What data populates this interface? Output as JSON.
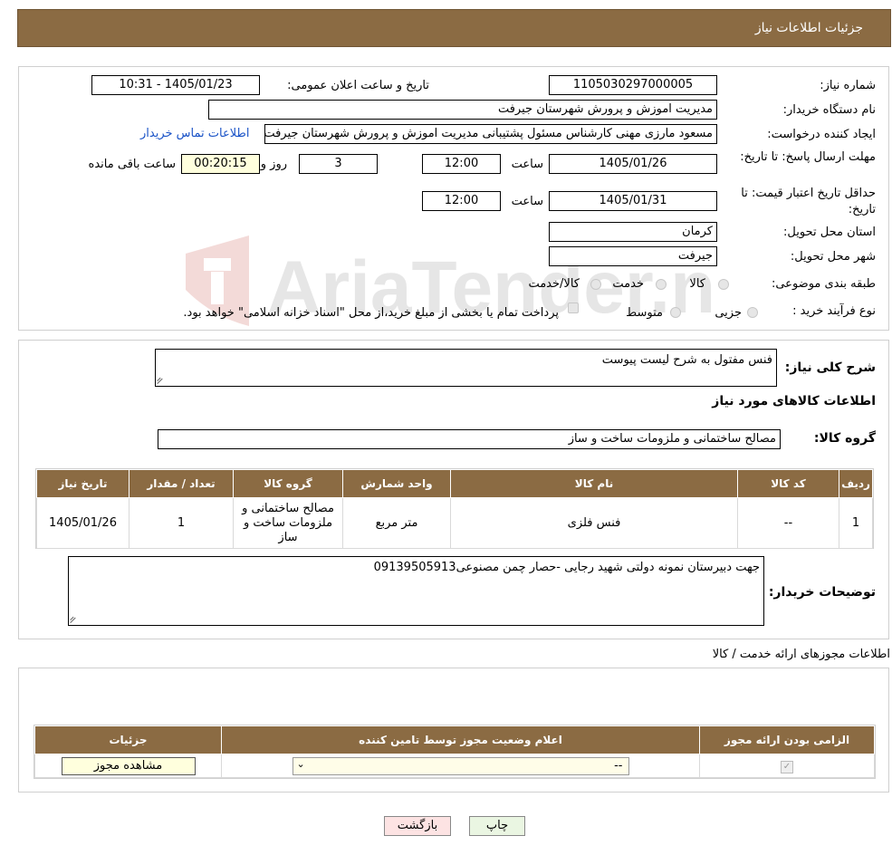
{
  "header": {
    "title": "جزئیات اطلاعات نیاز"
  },
  "watermark": {
    "text": "AriaTender.neT"
  },
  "form": {
    "need_number_label": "شماره نیاز:",
    "need_number": "1105030297000005",
    "announce_label": "تاریخ و ساعت اعلان عمومی:",
    "announce_value": "1405/01/23 - 10:31",
    "buyer_org_label": "نام دستگاه خریدار:",
    "buyer_org": "مدیریت اموزش و پرورش شهرستان جیرفت",
    "creator_label": "ایجاد کننده درخواست:",
    "creator": "مسعود  مارزی مهنی  کارشناس مسئول پشتیبانی  مدیریت اموزش و پرورش شهرستان جیرفت",
    "contact_link": "اطلاعات تماس خریدار",
    "reply_deadline_label": "مهلت ارسال پاسخ: تا تاریخ:",
    "reply_date": "1405/01/26",
    "time_label": "ساعت",
    "reply_time": "12:00",
    "days_value": "3",
    "days_label": "روز و",
    "remaining_value": "00:20:15",
    "remaining_label": "ساعت باقی مانده",
    "price_validity_label": "حداقل تاریخ اعتبار قیمت: تا تاریخ:",
    "price_date": "1405/01/31",
    "price_time": "12:00",
    "province_label": "استان محل تحویل:",
    "province": "کرمان",
    "city_label": "شهر محل تحویل:",
    "city": "جیرفت",
    "category_label": "طبقه بندی موضوعی:",
    "category_options": [
      "کالا",
      "خدمت",
      "کالا/خدمت"
    ],
    "purchase_type_label": "نوع فرآیند خرید :",
    "purchase_options": [
      "جزیی",
      "متوسط"
    ],
    "purchase_note": "پرداخت تمام یا بخشی از مبلغ خرید،از محل \"اسناد خزانه اسلامی\" خواهد بود."
  },
  "goods": {
    "summary_label": "شرح کلی نیاز:",
    "summary": "فنس مفتول به شرح لیست پیوست",
    "section_title": "اطلاعات کالاهای مورد نیاز",
    "group_label": "گروه کالا:",
    "group_value": "مصالح ساختمانی و ملزومات ساخت و ساز",
    "columns": [
      "ردیف",
      "کد کالا",
      "نام کالا",
      "واحد شمارش",
      "گروه کالا",
      "تعداد / مقدار",
      "تاریخ نیاز"
    ],
    "rows": [
      [
        "1",
        "--",
        "فنس فلزی",
        "متر مربع",
        "مصالح ساختمانی و ملزومات ساخت و ساز",
        "1",
        "1405/01/26"
      ]
    ],
    "buyer_notes_label": "توضیحات خریدار:",
    "buyer_notes": "جهت دبیرستان نمونه دولتی شهید رجایی -حصار چمن مصنوعی09139505913"
  },
  "permits": {
    "title": "اطلاعات مجوزهای ارائه خدمت / کالا",
    "columns": [
      "الزامی بودن ارائه مجوز",
      "اعلام وضعیت مجوز توسط تامین کننده",
      "جزئیات"
    ],
    "select_value": "--",
    "view_button": "مشاهده مجوز"
  },
  "buttons": {
    "print": "چاپ",
    "back": "بازگشت"
  },
  "colors": {
    "header": "#8b6b43",
    "back_button": "#fde3e3",
    "print_button": "#eaf6e2",
    "remaining_box": "#ffffdd",
    "link": "#1a53c7"
  }
}
